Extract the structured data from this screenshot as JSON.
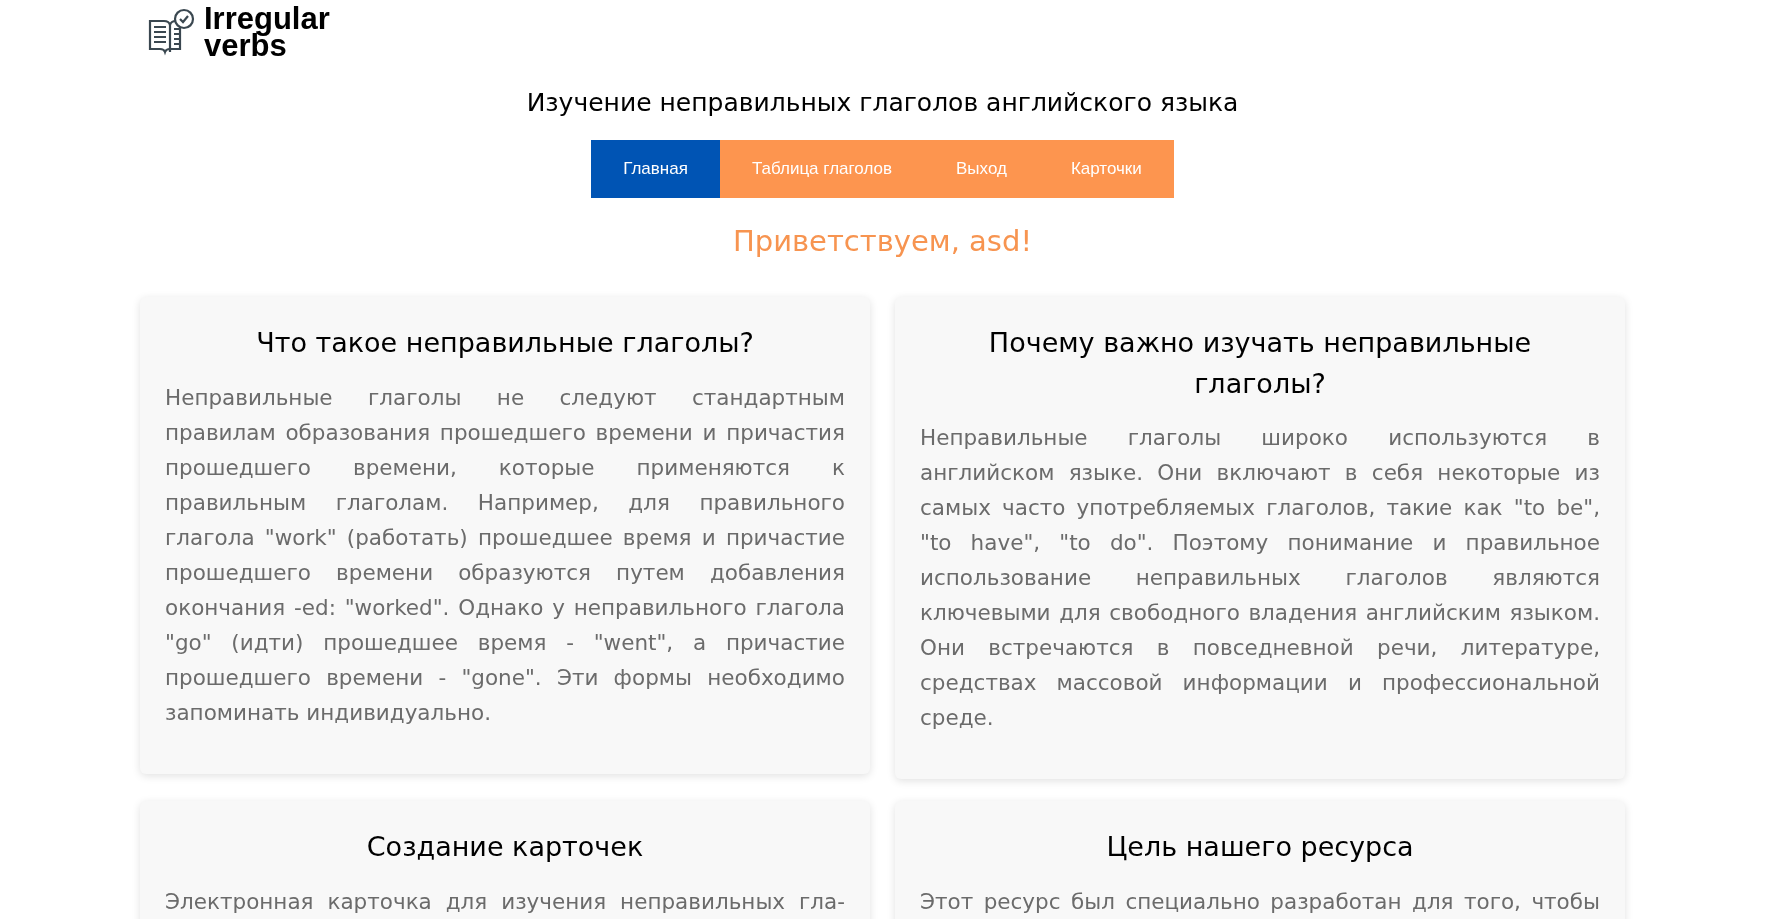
{
  "logo": {
    "line_1": "Irregular",
    "line_2": "verbs"
  },
  "heading": "Изучение неправильных глаголов английского языка",
  "nav": [
    {
      "label": "Главная",
      "selected": true
    },
    {
      "label": "Таблица глаголов",
      "selected": false
    },
    {
      "label": "Выход",
      "selected": false
    },
    {
      "label": "Карточки",
      "selected": false
    }
  ],
  "greeting": "Приветствуем, asd!",
  "cards": [
    {
      "title": "Что такое неправильные глаголы?",
      "text": "Неправильные глаголы не следуют стандартным правилам образования прошедшего времени и причастия прошедшего времени, которые применяются к правильным глаголам. Например, для правильного глагола \"work\" (работать) прошедшее время и причастие прошедшего времени образуются путем добавления окончания -ed: \"worked\". Однако у неправильного глагола \"go\" (идти) прошедшее время - \"went\", а причастие прошедшего времени - \"gone\". Эти формы необходимо запоминать индивидуально."
    },
    {
      "title": "Почему важно изучать неправильные глаголы?",
      "text": "Неправильные глаголы широко используются в английском языке. Они включают в себя некоторые из самых часто употребляемых глаголов, такие как \"to be\", \"to have\", \"to do\". Поэтому понимание и правильное использование неправильных глаголов являются ключевыми для свободного владения английским языком. Они встречаются в повседневной речи, литературе, средствах массовой информации и профессиональной среде."
    },
    {
      "title": "Создание карточек",
      "text": "Электронная карточка для изучения неправильных гла-"
    },
    {
      "title": "Цель нашего ресурса",
      "text": "Этот ресурс был специально разработан для того, чтобы"
    }
  ]
}
